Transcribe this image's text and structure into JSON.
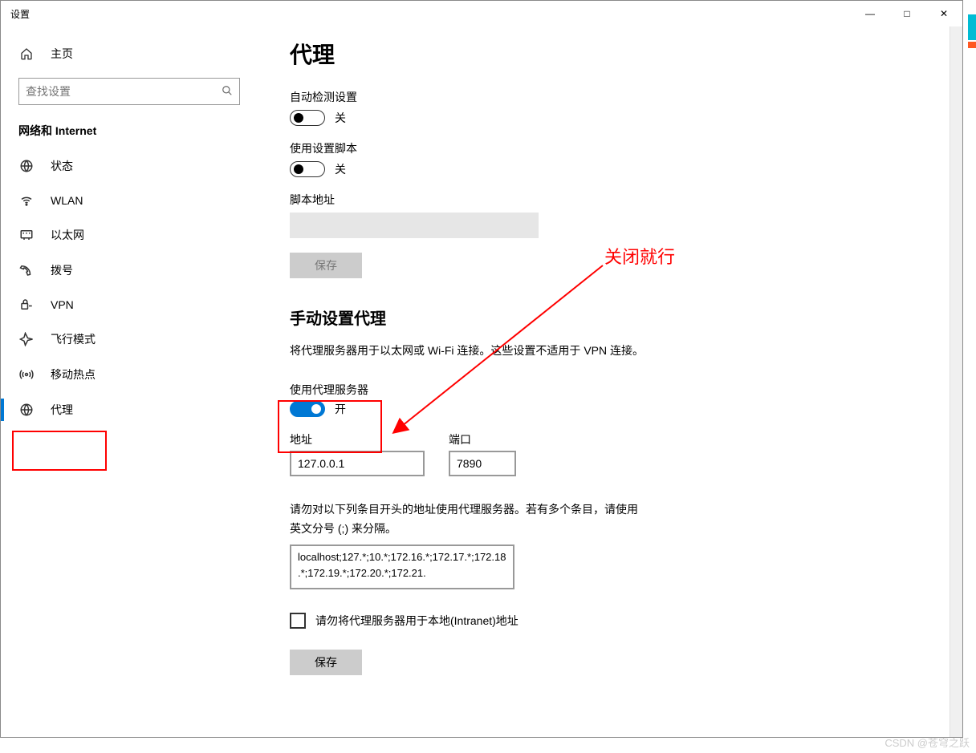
{
  "window": {
    "title": "设置"
  },
  "winbuttons": {
    "min": "—",
    "max": "□",
    "close": "✕"
  },
  "sidebar": {
    "home": "主页",
    "search_placeholder": "查找设置",
    "section": "网络和 Internet",
    "items": [
      {
        "icon": "status-icon",
        "label": "状态"
      },
      {
        "icon": "wifi-icon",
        "label": "WLAN"
      },
      {
        "icon": "ethernet-icon",
        "label": "以太网"
      },
      {
        "icon": "dialup-icon",
        "label": "拨号"
      },
      {
        "icon": "vpn-icon",
        "label": "VPN"
      },
      {
        "icon": "airplane-icon",
        "label": "飞行模式"
      },
      {
        "icon": "hotspot-icon",
        "label": "移动热点"
      },
      {
        "icon": "proxy-icon",
        "label": "代理"
      }
    ],
    "active_index": 7
  },
  "page": {
    "title": "代理",
    "auto_detect_label": "自动检测设置",
    "auto_detect_state": "关",
    "use_script_label": "使用设置脚本",
    "use_script_state": "关",
    "script_address_label": "脚本地址",
    "save1": "保存",
    "manual_section": "手动设置代理",
    "manual_desc": "将代理服务器用于以太网或 Wi-Fi 连接。这些设置不适用于 VPN 连接。",
    "use_proxy_label": "使用代理服务器",
    "use_proxy_state": "开",
    "address_label": "地址",
    "address_value": "127.0.0.1",
    "port_label": "端口",
    "port_value": "7890",
    "exclusion_desc": "请勿对以下列条目开头的地址使用代理服务器。若有多个条目，请使用英文分号 (;) 来分隔。",
    "exclusion_value": "localhost;127.*;10.*;172.16.*;172.17.*;172.18.*;172.19.*;172.20.*;172.21.",
    "local_bypass_label": "请勿将代理服务器用于本地(Intranet)地址",
    "save2": "保存"
  },
  "annotation": {
    "text": "关闭就行"
  },
  "watermark": "CSDN @苍穹之跃"
}
